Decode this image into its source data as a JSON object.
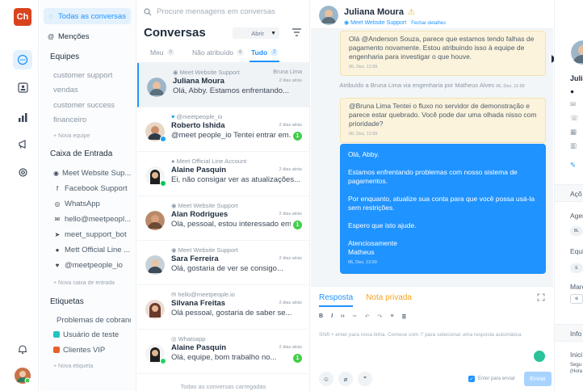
{
  "rail": {
    "logo_text": "Ch",
    "colors": {
      "logo": "#d8431e",
      "accent": "#1f93ff"
    }
  },
  "sidebar": {
    "all_conversations": "Todas as conversas",
    "mentions": "Menções",
    "teams_header": "Equipes",
    "teams": [
      "customer support",
      "vendas",
      "customer success",
      "financeiro"
    ],
    "new_team": "+ Nova equipe",
    "inbox_header": "Caixa de Entrada",
    "inboxes": [
      {
        "icon": "web-icon",
        "label": "Meet Website Sup..."
      },
      {
        "icon": "facebook-icon",
        "label": "Facebook Support"
      },
      {
        "icon": "whatsapp-icon",
        "label": "WhatsApp"
      },
      {
        "icon": "email-icon",
        "label": "hello@meetpeopl..."
      },
      {
        "icon": "telegram-icon",
        "label": "meet_support_bot"
      },
      {
        "icon": "line-icon",
        "label": "Mett Official Line ..."
      },
      {
        "icon": "twitter-icon",
        "label": "@meetpeople_io"
      }
    ],
    "new_inbox": "+ Nova caixa de entrada",
    "labels_header": "Etiquetas",
    "labels": [
      {
        "label": "Problemas de cobrança",
        "color": "#a855f7"
      },
      {
        "label": "Usuário de teste",
        "color": "#22c3c3"
      },
      {
        "label": "Clientes VIP",
        "color": "#e8602c"
      }
    ],
    "new_label": "+ Nova etiqueta"
  },
  "list": {
    "search_placeholder": "Procure mensagens em conversas",
    "title": "Conversas",
    "status_select": "Abrir",
    "tabs": [
      {
        "label": "Meu",
        "count": "0"
      },
      {
        "label": "Não atribuído",
        "count": "6"
      },
      {
        "label": "Tudo",
        "count": "7"
      }
    ],
    "conversations": [
      {
        "inbox": "Meet Website Support",
        "assignee": "Bruna Lima",
        "name": "Juliana Moura",
        "message": "Olá, Abby. Estamos enfrentando...",
        "time": "2 dias atrás",
        "badge": ""
      },
      {
        "inbox": "@meetpeople_io",
        "assignee": "",
        "name": "Roberto Ishida",
        "message": "@meet people_io Tentei entrar em...",
        "time": "2 dias atrás",
        "badge": "1"
      },
      {
        "inbox": "Meet Official Line Account",
        "assignee": "",
        "name": "Alaine Pasquin",
        "message": "Ei, não consigar ver as atualizações...",
        "time": "2 dias atrás",
        "badge": ""
      },
      {
        "inbox": "Meet Website Support",
        "assignee": "",
        "name": "Alan Rodrigues",
        "message": "Olá, pessoal, estou interessado em...",
        "time": "2 dias atrás",
        "badge": "1"
      },
      {
        "inbox": "Meet Website Support",
        "assignee": "",
        "name": "Sara Ferreira",
        "message": "Olá, gostaria de ver se consigo...",
        "time": "2 dias atrás",
        "badge": ""
      },
      {
        "inbox": "hello@meetpeople.io",
        "assignee": "",
        "name": "Silvana Freitas",
        "message": "Olá pessoal, gostaria de saber se...",
        "time": "2 dias atrás",
        "badge": ""
      },
      {
        "inbox": "Whatsapp",
        "assignee": "",
        "name": "Alaine Pasquin",
        "message": "Olá, equipe, bom trabalho no...",
        "time": "2 dias atrás",
        "badge": "1"
      }
    ],
    "all_loaded": "Todas as conversas carregadas"
  },
  "chat": {
    "contact_name": "Juliana Moura",
    "inbox": "Meet Website Support",
    "close_details": "Fechar detalhes",
    "private_note_1": "Olá @Anderson Souza, parece que estamos tendo falhas de pagamento novamente. Estou atribuindo isso à equipe de engenharia para investigar o que houve.",
    "private_note_1_time": "06, Dez, 11:59",
    "activity": "Atribuído a Bruna Lima via engenharia por Matheus Alves",
    "activity_time": "06, Dez, 11:59",
    "private_note_2": "@Bruna Lima Tentei o fluxo no servidor de demonstração e parece estar quebrado. Você pode dar uma olhada nisso com prioridade?",
    "private_note_2_time": "06, Dez, 11:59",
    "reply_paragraphs": [
      "Olá, Abby.",
      "Estamos enfrentando problemas com nosso sistema de pagamentos.",
      "Por enquanto, atualize sua conta para que você possa usá-la sem restrições.",
      "Espero que isto ajude.",
      "Atenciosamente\nMatheus"
    ],
    "reply_time": "06, Dez, 12:00"
  },
  "composer": {
    "tab_reply": "Resposta",
    "tab_private": "Nota privada",
    "format_buttons": [
      "B",
      "I",
      "<>",
      "link",
      "undo",
      "redo",
      "ul",
      "ol"
    ],
    "placeholder": "Shift + enter para nova linha. Comece com '/' para selecionar uma resposta automática",
    "enter_to_send": "Enter para enviar",
    "send": "Enviar"
  },
  "contact_panel": {
    "name_short": "Julia",
    "actions_header": "Açõ",
    "agent_label": "Agen",
    "agent_initials": "BL",
    "team_label": "Equi",
    "team_initials": "E",
    "labels_label": "Marc",
    "info_header": "Info",
    "initiated_label": "Inici",
    "followers_1": "Segu",
    "followers_2": "(Hora"
  }
}
